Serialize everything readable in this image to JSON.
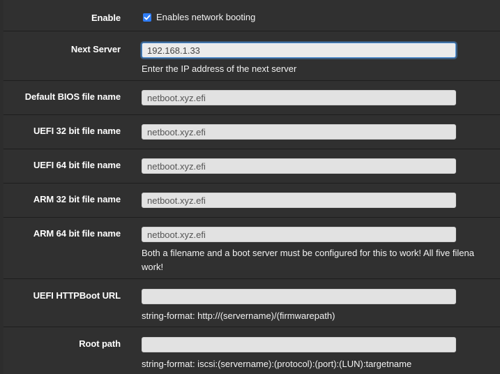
{
  "enable": {
    "label": "Enable",
    "checked": true,
    "checkbox_text": "Enables network booting"
  },
  "next_server": {
    "label": "Next Server",
    "value": "192.168.1.33",
    "help": "Enter the IP address of the next server"
  },
  "default_bios": {
    "label": "Default BIOS file name",
    "value": "netboot.xyz.efi"
  },
  "uefi32": {
    "label": "UEFI 32 bit file name",
    "value": "netboot.xyz.efi"
  },
  "uefi64": {
    "label": "UEFI 64 bit file name",
    "value": "netboot.xyz.efi"
  },
  "arm32": {
    "label": "ARM 32 bit file name",
    "value": "netboot.xyz.efi"
  },
  "arm64": {
    "label": "ARM 64 bit file name",
    "value": "netboot.xyz.efi",
    "help_line1": "Both a filename and a boot server must be configured for this to work! All five filena",
    "help_line2": "work!"
  },
  "httpboot": {
    "label": "UEFI HTTPBoot URL",
    "value": "",
    "help": "string-format: http://(servername)/(firmwarepath)"
  },
  "root_path": {
    "label": "Root path",
    "value": "",
    "help": "string-format: iscsi:(servername):(protocol):(port):(LUN):targetname"
  },
  "colors": {
    "page_bg": "#2d2d2d",
    "row_bg": "#303030",
    "input_bg": "#e2e2e2",
    "focus_border": "#4a90d9",
    "checkbox": "#2f7df6",
    "label_text": "#ffffff"
  }
}
